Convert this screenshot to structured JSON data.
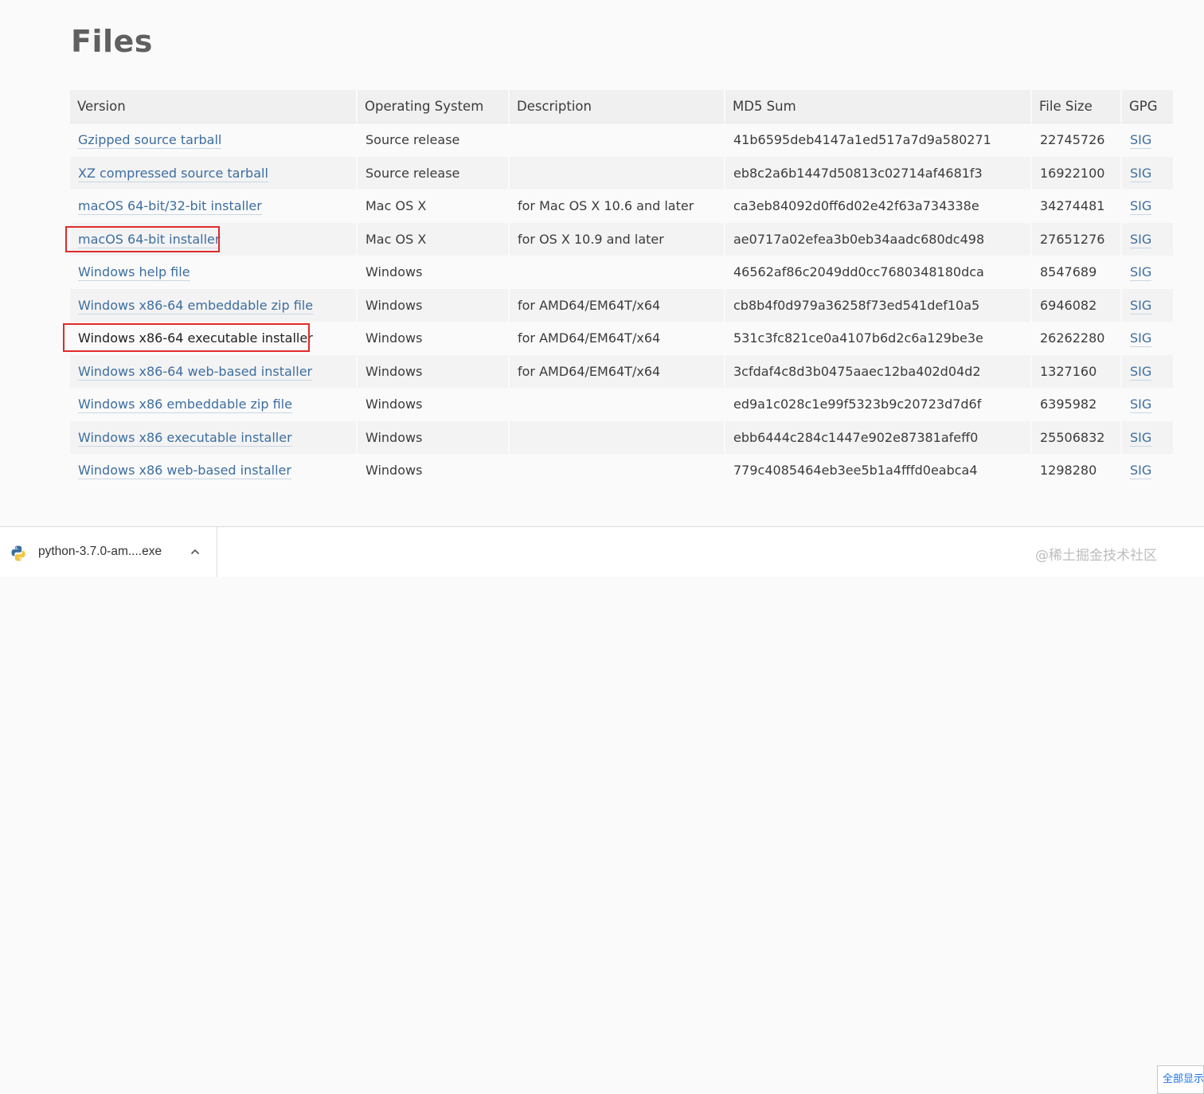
{
  "page": {
    "title": "Files"
  },
  "table": {
    "headers": {
      "version": "Version",
      "os": "Operating System",
      "description": "Description",
      "md5": "MD5 Sum",
      "size": "File Size",
      "gpg": "GPG"
    },
    "rows": [
      {
        "version": "Gzipped source tarball",
        "os": "Source release",
        "description": "",
        "md5": "41b6595deb4147a1ed517a7d9a580271",
        "size": "22745726",
        "gpg": "SIG"
      },
      {
        "version": "XZ compressed source tarball",
        "os": "Source release",
        "description": "",
        "md5": "eb8c2a6b1447d50813c02714af4681f3",
        "size": "16922100",
        "gpg": "SIG"
      },
      {
        "version": "macOS 64-bit/32-bit installer",
        "os": "Mac OS X",
        "description": "for Mac OS X 10.6 and later",
        "md5": "ca3eb84092d0ff6d02e42f63a734338e",
        "size": "34274481",
        "gpg": "SIG"
      },
      {
        "version": "macOS 64-bit installer",
        "os": "Mac OS X",
        "description": "for OS X 10.9 and later",
        "md5": "ae0717a02efea3b0eb34aadc680dc498",
        "size": "27651276",
        "gpg": "SIG"
      },
      {
        "version": "Windows help file",
        "os": "Windows",
        "description": "",
        "md5": "46562af86c2049dd0cc7680348180dca",
        "size": "8547689",
        "gpg": "SIG"
      },
      {
        "version": "Windows x86-64 embeddable zip file",
        "os": "Windows",
        "description": "for AMD64/EM64T/x64",
        "md5": "cb8b4f0d979a36258f73ed541def10a5",
        "size": "6946082",
        "gpg": "SIG"
      },
      {
        "version": "Windows x86-64 executable installer",
        "os": "Windows",
        "description": "for AMD64/EM64T/x64",
        "md5": "531c3fc821ce0a4107b6d2c6a129be3e",
        "size": "26262280",
        "gpg": "SIG"
      },
      {
        "version": "Windows x86-64 web-based installer",
        "os": "Windows",
        "description": "for AMD64/EM64T/x64",
        "md5": "3cfdaf4c8d3b0475aaec12ba402d04d2",
        "size": "1327160",
        "gpg": "SIG"
      },
      {
        "version": "Windows x86 embeddable zip file",
        "os": "Windows",
        "description": "",
        "md5": "ed9a1c028c1e99f5323b9c20723d7d6f",
        "size": "6395982",
        "gpg": "SIG"
      },
      {
        "version": "Windows x86 executable installer",
        "os": "Windows",
        "description": "",
        "md5": "ebb6444c284c1447e902e87381afeff0",
        "size": "25506832",
        "gpg": "SIG"
      },
      {
        "version": "Windows x86 web-based installer",
        "os": "Windows",
        "description": "",
        "md5": "779c4085464eb3ee5b1a4fffd0eabca4",
        "size": "1298280",
        "gpg": "SIG"
      }
    ]
  },
  "download_bar": {
    "file_name": "python-3.7.0-am....exe",
    "file_icon": "python-file-icon",
    "chevron_icon": "chevron-up-icon",
    "show_all_label": "全部显示",
    "watermark": "@稀土掘金技术社区"
  },
  "colors": {
    "link": "#3d6ea0",
    "highlight_box": "#e02a2a",
    "header_bg": "#f0f0f0",
    "stripe_bg": "#f3f3f3"
  }
}
